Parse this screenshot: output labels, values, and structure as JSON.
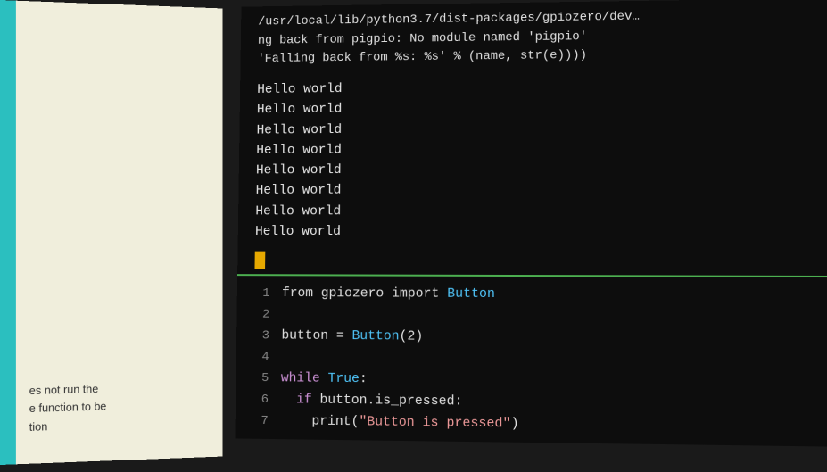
{
  "left_panel": {
    "teal_bar": true,
    "bottom_text_line1": "es not run the",
    "bottom_text_line2": "e function to be",
    "bottom_text_line3": "tion"
  },
  "terminal": {
    "error_lines": [
      "/usr/local/lib/python3.7/dist-packages/gpiozero/dev…",
      "ng back from pigpio: No module named 'pigpio'",
      "  'Falling back from %s: %s' % (name, str(e))))"
    ],
    "hello_world_lines": [
      "Hello world",
      "Hello world",
      "Hello world",
      "Hello world",
      "Hello world",
      "Hello world",
      "Hello world",
      "Hello world"
    ],
    "code_lines": [
      {
        "num": "1",
        "content": "from gpiozero import Button",
        "tokens": [
          "from",
          " gpiozero ",
          "import",
          " ",
          "Button"
        ]
      },
      {
        "num": "2",
        "content": "",
        "tokens": []
      },
      {
        "num": "3",
        "content": "button = Button(2)",
        "tokens": [
          "button ",
          "=",
          " ",
          "Button",
          "(2)"
        ]
      },
      {
        "num": "4",
        "content": "",
        "tokens": []
      },
      {
        "num": "5",
        "content": "while True:",
        "tokens": [
          "while",
          " ",
          "True",
          ":"
        ]
      },
      {
        "num": "6",
        "content": "  if button.is_pressed:",
        "tokens": [
          "  ",
          "if",
          " button.is_pressed:"
        ]
      },
      {
        "num": "7",
        "content": "    print(\"Button is pressed\")",
        "tokens": [
          "    print(",
          "\"Button is pressed\"",
          ")"
        ]
      }
    ]
  }
}
